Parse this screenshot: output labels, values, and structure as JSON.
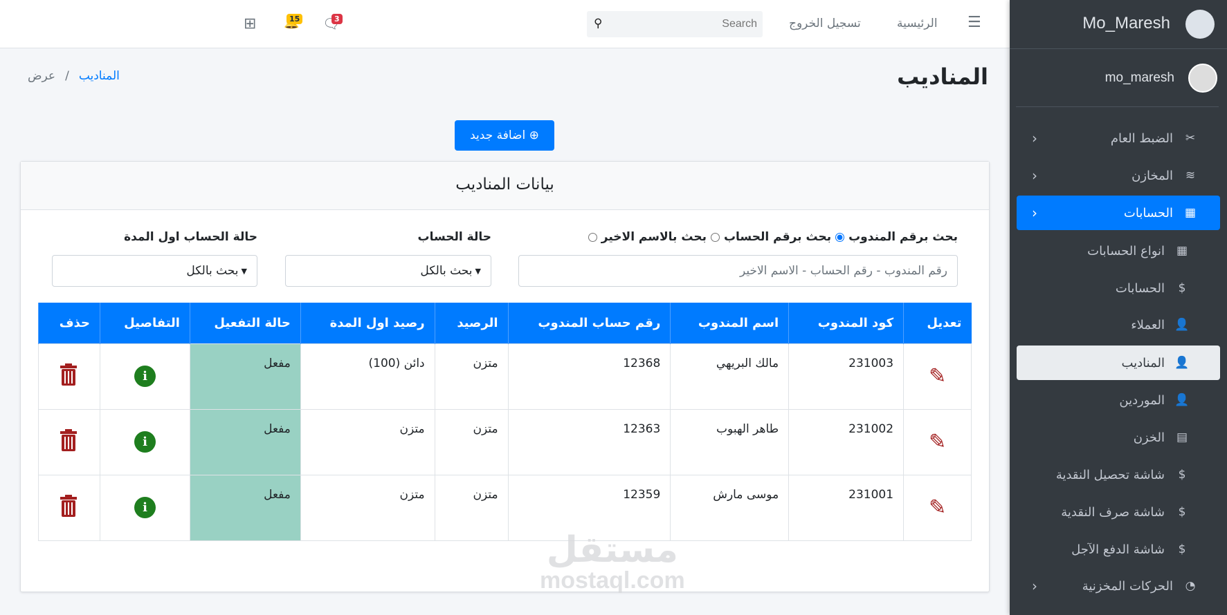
{
  "topbar": {
    "home": "الرئيسية",
    "logout": "تسجيل الخروج",
    "search_placeholder": "Search",
    "notifications_count": "15",
    "messages_count": "3"
  },
  "sidebar": {
    "brand": "Mo_Maresh",
    "user": "mo_maresh",
    "items": [
      {
        "label": "الضبط العام",
        "icon": "tools-icon"
      },
      {
        "label": "المخازن",
        "icon": "stack-icon"
      },
      {
        "label": "الحسابات",
        "icon": "money-chart-icon"
      },
      {
        "label": "انواع الحسابات",
        "icon": "table-icon"
      },
      {
        "label": "الحسابات",
        "icon": "dollar-icon"
      },
      {
        "label": "العملاء",
        "icon": "user-tag-icon"
      },
      {
        "label": "المناديب",
        "icon": "user-tag-icon"
      },
      {
        "label": "الموردين",
        "icon": "user-tag-icon"
      },
      {
        "label": "الخزن",
        "icon": "cash-register-icon"
      },
      {
        "label": "شاشة تحصيل النقدية",
        "icon": "hand-dollar-icon"
      },
      {
        "label": "شاشة صرف النقدية",
        "icon": "money-bag-icon"
      },
      {
        "label": "شاشة الدفع الآجل",
        "icon": "hand-dollar-icon"
      },
      {
        "label": "الحركات المخزنية",
        "icon": "gauge-icon"
      }
    ]
  },
  "page": {
    "title": "المناديب",
    "breadcrumb": [
      "المناديب",
      "عرض"
    ],
    "add_button": "اضافة جديد"
  },
  "card": {
    "title": "بيانات المناديب",
    "radios": [
      {
        "label": "بحث برقم المندوب",
        "checked": true
      },
      {
        "label": "بحث برقم الحساب",
        "checked": false
      },
      {
        "label": "بحث بالاسم الاخير",
        "checked": false
      }
    ],
    "search_placeholder": "رقم المندوب - رقم الحساب - الاسم الاخير",
    "status_label": "حالة الحساب",
    "status_value": "بحث بالكل",
    "start_status_label": "حالة الحساب اول المدة",
    "start_status_value": "بحث بالكل"
  },
  "table": {
    "headers": [
      "تعديل",
      "كود المندوب",
      "اسم المندوب",
      "رقم حساب المندوب",
      "الرصيد",
      "رصيد اول المدة",
      "حالة التفعيل",
      "التفاصيل",
      "حذف"
    ],
    "rows": [
      {
        "code": "231003",
        "name": "مالك البريهي",
        "account": "12368",
        "balance": "متزن",
        "start_balance": "دائن (100)",
        "status": "مفعل"
      },
      {
        "code": "231002",
        "name": "طاهر الهبوب",
        "account": "12363",
        "balance": "متزن",
        "start_balance": "متزن",
        "status": "مفعل"
      },
      {
        "code": "231001",
        "name": "موسى مارش",
        "account": "12359",
        "balance": "متزن",
        "start_balance": "متزن",
        "status": "مفعل"
      }
    ]
  },
  "watermark": {
    "ar": "مستقل",
    "en": "mostaql.com"
  }
}
